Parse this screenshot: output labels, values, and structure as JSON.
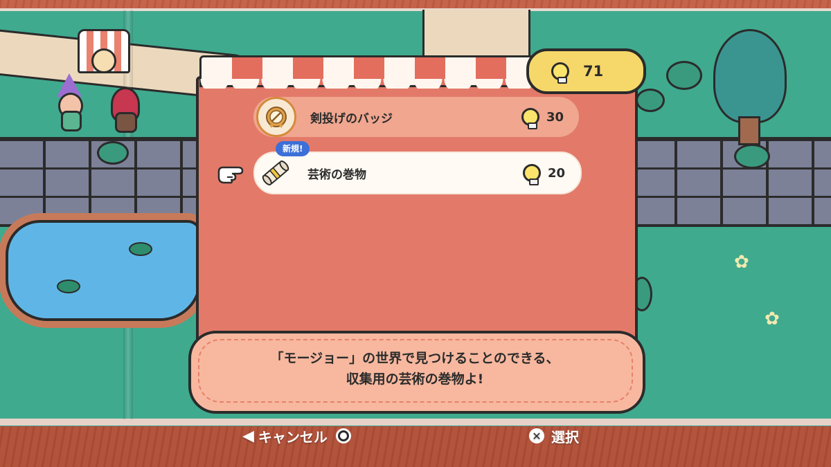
{
  "currency": {
    "count": "71",
    "icon": "lightbulb-icon"
  },
  "shop": {
    "items": [
      {
        "name": "剣投げのバッジ",
        "price": "30",
        "icon": "sword-badge-icon",
        "new": false
      },
      {
        "name": "芸術の巻物",
        "price": "20",
        "icon": "scroll-icon",
        "new": true,
        "new_label": "新規!"
      }
    ]
  },
  "dialog": {
    "line1": "「モージョー」の世界で見つけることのできる、",
    "line2": "収集用の芸術の巻物よ!"
  },
  "controls": {
    "cancel_label": "キャンセル",
    "select_label": "選択"
  },
  "colors": {
    "shop_panel": "#e37a69",
    "new_badge": "#3c6fd8",
    "counter": "#f6d86a",
    "dialog": "#f7b89f",
    "book_page": "#3faa8e"
  }
}
